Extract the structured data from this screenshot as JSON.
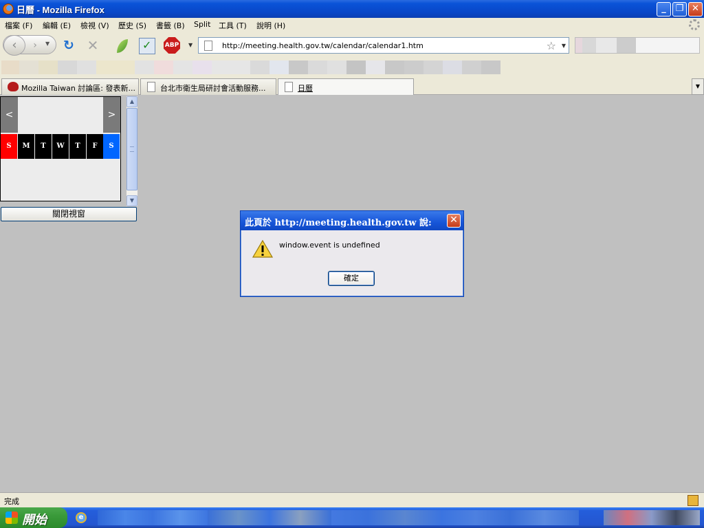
{
  "window": {
    "title": "日曆 - Mozilla Firefox",
    "buttons": {
      "minimize": "_",
      "restore": "❐",
      "close": "✕"
    }
  },
  "menu": [
    "檔案 (F)",
    "編輯 (E)",
    "檢視 (V)",
    "歷史 (S)",
    "書籤 (B)",
    "Split",
    "工具 (T)",
    "說明 (H)"
  ],
  "toolbar": {
    "back": "‹",
    "forward": "›",
    "reload": "↻",
    "stop": "✕",
    "abp_label": "ABP",
    "url": "http://meeting.health.gov.tw/calendar/calendar1.htm",
    "icons": [
      "back-icon",
      "forward-icon",
      "reload-icon",
      "stop-icon",
      "leaf-icon",
      "validator-icon",
      "adblock-plus-icon",
      "bookmark-star-icon"
    ]
  },
  "tabs": [
    {
      "label": "Mozilla Taiwan 討論區: 發表新...",
      "active": false
    },
    {
      "label": "台北市衛生局研討會活動服務...",
      "active": false
    },
    {
      "label": "日曆",
      "active": true
    }
  ],
  "calendar": {
    "prev": "<",
    "next": ">",
    "days": [
      "S",
      "M",
      "T",
      "W",
      "T",
      "F",
      "S"
    ],
    "day_colors": [
      "#ff0000",
      "#000000",
      "#000000",
      "#000000",
      "#000000",
      "#000000",
      "#0066ff"
    ],
    "close_button": "關閉視窗"
  },
  "dialog": {
    "title": "此頁於 http://meeting.health.gov.tw 說:",
    "message": "window.event is undefined",
    "ok_button": "確定",
    "icon": "warning-icon"
  },
  "status": {
    "text": "完成"
  },
  "taskbar": {
    "start_label": "開始"
  },
  "colors": {
    "titlebar": "#0a53d8",
    "content_bg": "#c0c0c0",
    "chrome_bg": "#ece9d8"
  }
}
